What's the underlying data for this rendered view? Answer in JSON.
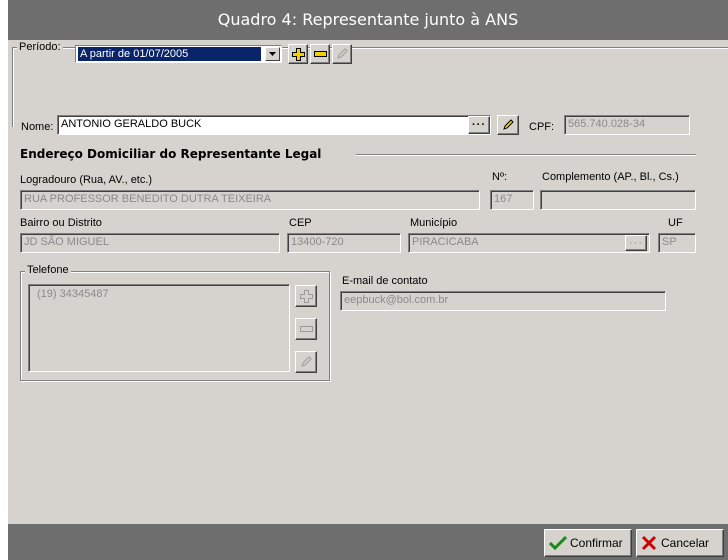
{
  "window": {
    "title": "Quadro 4: Representante junto à ANS"
  },
  "periodo": {
    "label": "Período:",
    "selected": "A partir de 01/07/2005"
  },
  "nome": {
    "label": "Nome:",
    "value": "ANTONIO GERALDO BUCK"
  },
  "cpf": {
    "label": "CPF:",
    "value": "565.740.028-34"
  },
  "endereco": {
    "title": "Endereço Domiciliar do Representante Legal",
    "logradouro_label": "Logradouro (Rua, AV., etc.)",
    "logradouro_value": "RUA PROFESSOR BENEDITO DUTRA TEIXEIRA",
    "numero_label": "Nº:",
    "numero_value": "167",
    "complemento_label": "Complemento (AP., Bl., Cs.)",
    "complemento_value": "",
    "bairro_label": "Bairro ou Distrito",
    "bairro_value": "JD SÃO MIGUEL",
    "cep_label": "CEP",
    "cep_value": "13400-720",
    "municipio_label": "Município",
    "municipio_value": "PIRACICABA",
    "uf_label": "UF",
    "uf_value": "SP"
  },
  "telefone": {
    "label": "Telefone",
    "items": [
      "(19) 34345487"
    ]
  },
  "email": {
    "label": "E-mail de contato",
    "value": "eepbuck@bol.com.br"
  },
  "actions": {
    "confirm_label": "Confirmar",
    "cancel_label": "Cancelar"
  },
  "colors": {
    "titlebar": "#6e6e6e",
    "form_bg": "#d6d3ce",
    "selection": "#0a246a",
    "add_icon": "#f5d000",
    "confirm_check": "#1a8a1a",
    "cancel_x": "#cc0000"
  }
}
